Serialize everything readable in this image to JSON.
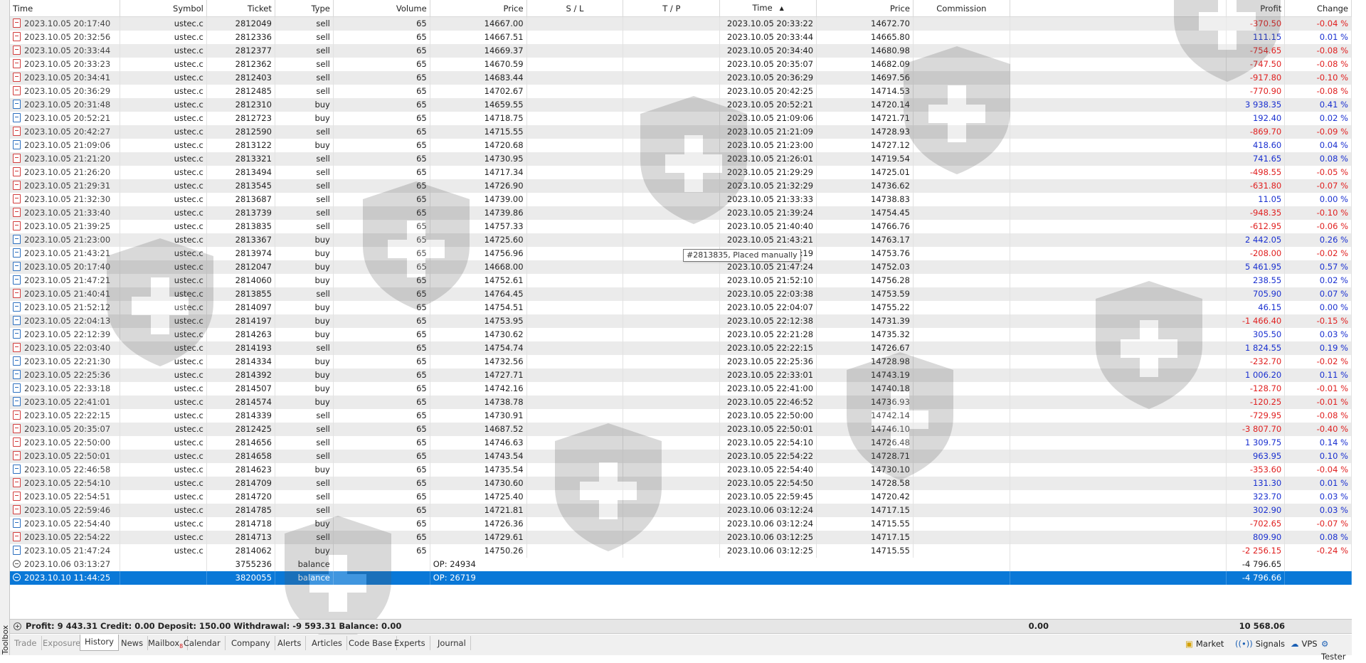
{
  "toolbox_label": "Toolbox",
  "columns": [
    "Time",
    "Symbol",
    "Ticket",
    "Type",
    "Volume",
    "Price",
    "S / L",
    "T / P",
    "Time",
    "Price",
    "Commission",
    "",
    "Profit",
    "Change"
  ],
  "rows": [
    {
      "otime": "2023.10.05 20:17:40",
      "symbol": "ustec.c",
      "ticket": "2812049",
      "type": "sell",
      "volume": "65",
      "oprice": "14667.00",
      "sl": "",
      "tp": "",
      "ctime": "2023.10.05 20:33:22",
      "cprice": "14672.70",
      "commission": "",
      "profit": "-370.50",
      "change": "-0.04 %"
    },
    {
      "otime": "2023.10.05 20:32:56",
      "symbol": "ustec.c",
      "ticket": "2812336",
      "type": "sell",
      "volume": "65",
      "oprice": "14667.51",
      "sl": "",
      "tp": "",
      "ctime": "2023.10.05 20:33:44",
      "cprice": "14665.80",
      "commission": "",
      "profit": "111.15",
      "change": "0.01 %"
    },
    {
      "otime": "2023.10.05 20:33:44",
      "symbol": "ustec.c",
      "ticket": "2812377",
      "type": "sell",
      "volume": "65",
      "oprice": "14669.37",
      "sl": "",
      "tp": "",
      "ctime": "2023.10.05 20:34:40",
      "cprice": "14680.98",
      "commission": "",
      "profit": "-754.65",
      "change": "-0.08 %"
    },
    {
      "otime": "2023.10.05 20:33:23",
      "symbol": "ustec.c",
      "ticket": "2812362",
      "type": "sell",
      "volume": "65",
      "oprice": "14670.59",
      "sl": "",
      "tp": "",
      "ctime": "2023.10.05 20:35:07",
      "cprice": "14682.09",
      "commission": "",
      "profit": "-747.50",
      "change": "-0.08 %"
    },
    {
      "otime": "2023.10.05 20:34:41",
      "symbol": "ustec.c",
      "ticket": "2812403",
      "type": "sell",
      "volume": "65",
      "oprice": "14683.44",
      "sl": "",
      "tp": "",
      "ctime": "2023.10.05 20:36:29",
      "cprice": "14697.56",
      "commission": "",
      "profit": "-917.80",
      "change": "-0.10 %"
    },
    {
      "otime": "2023.10.05 20:36:29",
      "symbol": "ustec.c",
      "ticket": "2812485",
      "type": "sell",
      "volume": "65",
      "oprice": "14702.67",
      "sl": "",
      "tp": "",
      "ctime": "2023.10.05 20:42:25",
      "cprice": "14714.53",
      "commission": "",
      "profit": "-770.90",
      "change": "-0.08 %"
    },
    {
      "otime": "2023.10.05 20:31:48",
      "symbol": "ustec.c",
      "ticket": "2812310",
      "type": "buy",
      "volume": "65",
      "oprice": "14659.55",
      "sl": "",
      "tp": "",
      "ctime": "2023.10.05 20:52:21",
      "cprice": "14720.14",
      "commission": "",
      "profit": "3 938.35",
      "change": "0.41 %"
    },
    {
      "otime": "2023.10.05 20:52:21",
      "symbol": "ustec.c",
      "ticket": "2812723",
      "type": "buy",
      "volume": "65",
      "oprice": "14718.75",
      "sl": "",
      "tp": "",
      "ctime": "2023.10.05 21:09:06",
      "cprice": "14721.71",
      "commission": "",
      "profit": "192.40",
      "change": "0.02 %"
    },
    {
      "otime": "2023.10.05 20:42:27",
      "symbol": "ustec.c",
      "ticket": "2812590",
      "type": "sell",
      "volume": "65",
      "oprice": "14715.55",
      "sl": "",
      "tp": "",
      "ctime": "2023.10.05 21:21:09",
      "cprice": "14728.93",
      "commission": "",
      "profit": "-869.70",
      "change": "-0.09 %"
    },
    {
      "otime": "2023.10.05 21:09:06",
      "symbol": "ustec.c",
      "ticket": "2813122",
      "type": "buy",
      "volume": "65",
      "oprice": "14720.68",
      "sl": "",
      "tp": "",
      "ctime": "2023.10.05 21:23:00",
      "cprice": "14727.12",
      "commission": "",
      "profit": "418.60",
      "change": "0.04 %"
    },
    {
      "otime": "2023.10.05 21:21:20",
      "symbol": "ustec.c",
      "ticket": "2813321",
      "type": "sell",
      "volume": "65",
      "oprice": "14730.95",
      "sl": "",
      "tp": "",
      "ctime": "2023.10.05 21:26:01",
      "cprice": "14719.54",
      "commission": "",
      "profit": "741.65",
      "change": "0.08 %"
    },
    {
      "otime": "2023.10.05 21:26:20",
      "symbol": "ustec.c",
      "ticket": "2813494",
      "type": "sell",
      "volume": "65",
      "oprice": "14717.34",
      "sl": "",
      "tp": "",
      "ctime": "2023.10.05 21:29:29",
      "cprice": "14725.01",
      "commission": "",
      "profit": "-498.55",
      "change": "-0.05 %"
    },
    {
      "otime": "2023.10.05 21:29:31",
      "symbol": "ustec.c",
      "ticket": "2813545",
      "type": "sell",
      "volume": "65",
      "oprice": "14726.90",
      "sl": "",
      "tp": "",
      "ctime": "2023.10.05 21:32:29",
      "cprice": "14736.62",
      "commission": "",
      "profit": "-631.80",
      "change": "-0.07 %"
    },
    {
      "otime": "2023.10.05 21:32:30",
      "symbol": "ustec.c",
      "ticket": "2813687",
      "type": "sell",
      "volume": "65",
      "oprice": "14739.00",
      "sl": "",
      "tp": "",
      "ctime": "2023.10.05 21:33:33",
      "cprice": "14738.83",
      "commission": "",
      "profit": "11.05",
      "change": "0.00 %"
    },
    {
      "otime": "2023.10.05 21:33:40",
      "symbol": "ustec.c",
      "ticket": "2813739",
      "type": "sell",
      "volume": "65",
      "oprice": "14739.86",
      "sl": "",
      "tp": "",
      "ctime": "2023.10.05 21:39:24",
      "cprice": "14754.45",
      "commission": "",
      "profit": "-948.35",
      "change": "-0.10 %"
    },
    {
      "otime": "2023.10.05 21:39:25",
      "symbol": "ustec.c",
      "ticket": "2813835",
      "type": "sell",
      "volume": "65",
      "oprice": "14757.33",
      "sl": "",
      "tp": "",
      "ctime": "2023.10.05 21:40:40",
      "cprice": "14766.76",
      "commission": "",
      "profit": "-612.95",
      "change": "-0.06 %"
    },
    {
      "otime": "2023.10.05 21:23:00",
      "symbol": "ustec.c",
      "ticket": "2813367",
      "type": "buy",
      "volume": "65",
      "oprice": "14725.60",
      "sl": "",
      "tp": "",
      "ctime": "2023.10.05 21:43:21",
      "cprice": "14763.17",
      "commission": "",
      "profit": "2 442.05",
      "change": "0.26 %"
    },
    {
      "otime": "2023.10.05 21:43:21",
      "symbol": "ustec.c",
      "ticket": "2813974",
      "type": "buy",
      "volume": "65",
      "oprice": "14756.96",
      "sl": "",
      "tp": "",
      "ctime": "2023.10.05 21:47:19",
      "cprice": "14753.76",
      "commission": "",
      "profit": "-208.00",
      "change": "-0.02 %"
    },
    {
      "otime": "2023.10.05 20:17:40",
      "symbol": "ustec.c",
      "ticket": "2812047",
      "type": "buy",
      "volume": "65",
      "oprice": "14668.00",
      "sl": "",
      "tp": "",
      "ctime": "2023.10.05 21:47:24",
      "cprice": "14752.03",
      "commission": "",
      "profit": "5 461.95",
      "change": "0.57 %"
    },
    {
      "otime": "2023.10.05 21:47:21",
      "symbol": "ustec.c",
      "ticket": "2814060",
      "type": "buy",
      "volume": "65",
      "oprice": "14752.61",
      "sl": "",
      "tp": "",
      "ctime": "2023.10.05 21:52:10",
      "cprice": "14756.28",
      "commission": "",
      "profit": "238.55",
      "change": "0.02 %"
    },
    {
      "otime": "2023.10.05 21:40:41",
      "symbol": "ustec.c",
      "ticket": "2813855",
      "type": "sell",
      "volume": "65",
      "oprice": "14764.45",
      "sl": "",
      "tp": "",
      "ctime": "2023.10.05 22:03:38",
      "cprice": "14753.59",
      "commission": "",
      "profit": "705.90",
      "change": "0.07 %"
    },
    {
      "otime": "2023.10.05 21:52:12",
      "symbol": "ustec.c",
      "ticket": "2814097",
      "type": "buy",
      "volume": "65",
      "oprice": "14754.51",
      "sl": "",
      "tp": "",
      "ctime": "2023.10.05 22:04:07",
      "cprice": "14755.22",
      "commission": "",
      "profit": "46.15",
      "change": "0.00 %"
    },
    {
      "otime": "2023.10.05 22:04:13",
      "symbol": "ustec.c",
      "ticket": "2814197",
      "type": "buy",
      "volume": "65",
      "oprice": "14753.95",
      "sl": "",
      "tp": "",
      "ctime": "2023.10.05 22:12:38",
      "cprice": "14731.39",
      "commission": "",
      "profit": "-1 466.40",
      "change": "-0.15 %"
    },
    {
      "otime": "2023.10.05 22:12:39",
      "symbol": "ustec.c",
      "ticket": "2814263",
      "type": "buy",
      "volume": "65",
      "oprice": "14730.62",
      "sl": "",
      "tp": "",
      "ctime": "2023.10.05 22:21:28",
      "cprice": "14735.32",
      "commission": "",
      "profit": "305.50",
      "change": "0.03 %"
    },
    {
      "otime": "2023.10.05 22:03:40",
      "symbol": "ustec.c",
      "ticket": "2814193",
      "type": "sell",
      "volume": "65",
      "oprice": "14754.74",
      "sl": "",
      "tp": "",
      "ctime": "2023.10.05 22:22:15",
      "cprice": "14726.67",
      "commission": "",
      "profit": "1 824.55",
      "change": "0.19 %"
    },
    {
      "otime": "2023.10.05 22:21:30",
      "symbol": "ustec.c",
      "ticket": "2814334",
      "type": "buy",
      "volume": "65",
      "oprice": "14732.56",
      "sl": "",
      "tp": "",
      "ctime": "2023.10.05 22:25:36",
      "cprice": "14728.98",
      "commission": "",
      "profit": "-232.70",
      "change": "-0.02 %"
    },
    {
      "otime": "2023.10.05 22:25:36",
      "symbol": "ustec.c",
      "ticket": "2814392",
      "type": "buy",
      "volume": "65",
      "oprice": "14727.71",
      "sl": "",
      "tp": "",
      "ctime": "2023.10.05 22:33:01",
      "cprice": "14743.19",
      "commission": "",
      "profit": "1 006.20",
      "change": "0.11 %"
    },
    {
      "otime": "2023.10.05 22:33:18",
      "symbol": "ustec.c",
      "ticket": "2814507",
      "type": "buy",
      "volume": "65",
      "oprice": "14742.16",
      "sl": "",
      "tp": "",
      "ctime": "2023.10.05 22:41:00",
      "cprice": "14740.18",
      "commission": "",
      "profit": "-128.70",
      "change": "-0.01 %"
    },
    {
      "otime": "2023.10.05 22:41:01",
      "symbol": "ustec.c",
      "ticket": "2814574",
      "type": "buy",
      "volume": "65",
      "oprice": "14738.78",
      "sl": "",
      "tp": "",
      "ctime": "2023.10.05 22:46:52",
      "cprice": "14736.93",
      "commission": "",
      "profit": "-120.25",
      "change": "-0.01 %"
    },
    {
      "otime": "2023.10.05 22:22:15",
      "symbol": "ustec.c",
      "ticket": "2814339",
      "type": "sell",
      "volume": "65",
      "oprice": "14730.91",
      "sl": "",
      "tp": "",
      "ctime": "2023.10.05 22:50:00",
      "cprice": "14742.14",
      "commission": "",
      "profit": "-729.95",
      "change": "-0.08 %"
    },
    {
      "otime": "2023.10.05 20:35:07",
      "symbol": "ustec.c",
      "ticket": "2812425",
      "type": "sell",
      "volume": "65",
      "oprice": "14687.52",
      "sl": "",
      "tp": "",
      "ctime": "2023.10.05 22:50:01",
      "cprice": "14746.10",
      "commission": "",
      "profit": "-3 807.70",
      "change": "-0.40 %"
    },
    {
      "otime": "2023.10.05 22:50:00",
      "symbol": "ustec.c",
      "ticket": "2814656",
      "type": "sell",
      "volume": "65",
      "oprice": "14746.63",
      "sl": "",
      "tp": "",
      "ctime": "2023.10.05 22:54:10",
      "cprice": "14726.48",
      "commission": "",
      "profit": "1 309.75",
      "change": "0.14 %"
    },
    {
      "otime": "2023.10.05 22:50:01",
      "symbol": "ustec.c",
      "ticket": "2814658",
      "type": "sell",
      "volume": "65",
      "oprice": "14743.54",
      "sl": "",
      "tp": "",
      "ctime": "2023.10.05 22:54:22",
      "cprice": "14728.71",
      "commission": "",
      "profit": "963.95",
      "change": "0.10 %"
    },
    {
      "otime": "2023.10.05 22:46:58",
      "symbol": "ustec.c",
      "ticket": "2814623",
      "type": "buy",
      "volume": "65",
      "oprice": "14735.54",
      "sl": "",
      "tp": "",
      "ctime": "2023.10.05 22:54:40",
      "cprice": "14730.10",
      "commission": "",
      "profit": "-353.60",
      "change": "-0.04 %"
    },
    {
      "otime": "2023.10.05 22:54:10",
      "symbol": "ustec.c",
      "ticket": "2814709",
      "type": "sell",
      "volume": "65",
      "oprice": "14730.60",
      "sl": "",
      "tp": "",
      "ctime": "2023.10.05 22:54:50",
      "cprice": "14728.58",
      "commission": "",
      "profit": "131.30",
      "change": "0.01 %"
    },
    {
      "otime": "2023.10.05 22:54:51",
      "symbol": "ustec.c",
      "ticket": "2814720",
      "type": "sell",
      "volume": "65",
      "oprice": "14725.40",
      "sl": "",
      "tp": "",
      "ctime": "2023.10.05 22:59:45",
      "cprice": "14720.42",
      "commission": "",
      "profit": "323.70",
      "change": "0.03 %"
    },
    {
      "otime": "2023.10.05 22:59:46",
      "symbol": "ustec.c",
      "ticket": "2814785",
      "type": "sell",
      "volume": "65",
      "oprice": "14721.81",
      "sl": "",
      "tp": "",
      "ctime": "2023.10.06 03:12:24",
      "cprice": "14717.15",
      "commission": "",
      "profit": "302.90",
      "change": "0.03 %"
    },
    {
      "otime": "2023.10.05 22:54:40",
      "symbol": "ustec.c",
      "ticket": "2814718",
      "type": "buy",
      "volume": "65",
      "oprice": "14726.36",
      "sl": "",
      "tp": "",
      "ctime": "2023.10.06 03:12:24",
      "cprice": "14715.55",
      "commission": "",
      "profit": "-702.65",
      "change": "-0.07 %"
    },
    {
      "otime": "2023.10.05 22:54:22",
      "symbol": "ustec.c",
      "ticket": "2814713",
      "type": "sell",
      "volume": "65",
      "oprice": "14729.61",
      "sl": "",
      "tp": "",
      "ctime": "2023.10.06 03:12:25",
      "cprice": "14717.15",
      "commission": "",
      "profit": "809.90",
      "change": "0.08 %"
    },
    {
      "otime": "2023.10.05 21:47:24",
      "symbol": "ustec.c",
      "ticket": "2814062",
      "type": "buy",
      "volume": "65",
      "oprice": "14750.26",
      "sl": "",
      "tp": "",
      "ctime": "2023.10.06 03:12:25",
      "cprice": "14715.55",
      "commission": "",
      "profit": "-2 256.15",
      "change": "-0.24 %"
    }
  ],
  "balance_rows": [
    {
      "time": "2023.10.06 03:13:27",
      "ticket": "3755236",
      "type": "balance",
      "comment": "OP: 24934",
      "profit": "-4 796.65"
    },
    {
      "time": "2023.10.10 11:44:25",
      "ticket": "3820055",
      "type": "balance",
      "comment": "OP: 26719",
      "profit": "-4 796.66"
    }
  ],
  "tooltip": "#2813835, Placed manually",
  "summary": {
    "text": "Profit: 9 443.31  Credit: 0.00  Deposit: 150.00  Withdrawal: -9 593.31  Balance: 0.00",
    "commission": "0.00",
    "profit": "10 568.06"
  },
  "tabs": [
    "Trade",
    "Exposure",
    "History",
    "News",
    "Mailbox",
    "Calendar",
    "Company",
    "Alerts",
    "Articles",
    "Code Base",
    "Experts",
    "Journal"
  ],
  "active_tab": "History",
  "mailbox_badge": "8",
  "right_tabs": [
    {
      "label": "Market",
      "icon": "market-bag-icon"
    },
    {
      "label": "Signals",
      "icon": "signals-icon"
    },
    {
      "label": "VPS",
      "icon": "vps-cloud-icon"
    },
    {
      "label": "Tester",
      "icon": "tester-gear-icon"
    }
  ],
  "colors": {
    "negative": "#e02020",
    "positive": "#1a30d0",
    "selected": "#0a78d7"
  }
}
